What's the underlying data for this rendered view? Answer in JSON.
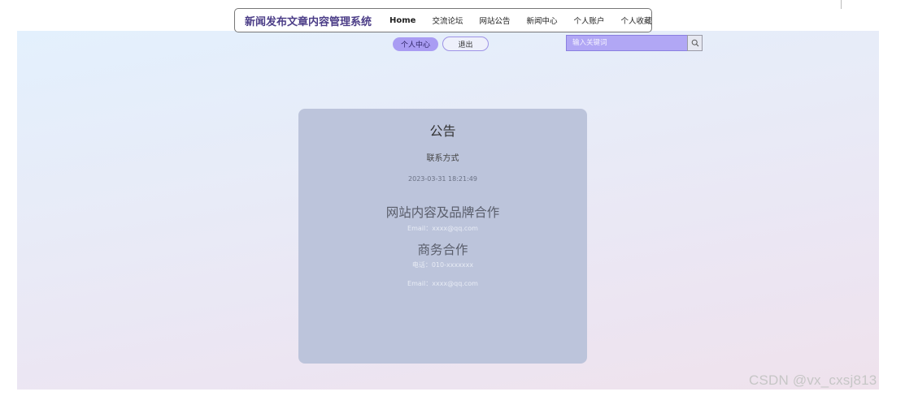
{
  "header": {
    "site_title": "新闻发布文章内容管理系统",
    "nav": [
      {
        "label": "Home"
      },
      {
        "label": "交流论坛"
      },
      {
        "label": "网站公告"
      },
      {
        "label": "新闻中心"
      },
      {
        "label": "个人账户"
      },
      {
        "label": "个人收藏"
      }
    ]
  },
  "user_actions": {
    "center_label": "个人中心",
    "logout_label": "退出"
  },
  "search": {
    "placeholder": "输入关键词",
    "icon": "search-icon"
  },
  "notice": {
    "heading": "公告",
    "title": "联系方式",
    "date": "2023-03-31 18:21:49",
    "content": {
      "section1_title": "网站内容及品牌合作",
      "section1_email": "Email：xxxx@qq.com",
      "section2_title": "商务合作",
      "section2_phone": "电话：010-xxxxxxx",
      "section2_email": "Email：xxxx@qq.com"
    }
  },
  "watermark": "CSDN @vx_cxsj813",
  "colors": {
    "accent": "#a99cf3",
    "title": "#4b3d87",
    "card": "#bcc4db"
  }
}
